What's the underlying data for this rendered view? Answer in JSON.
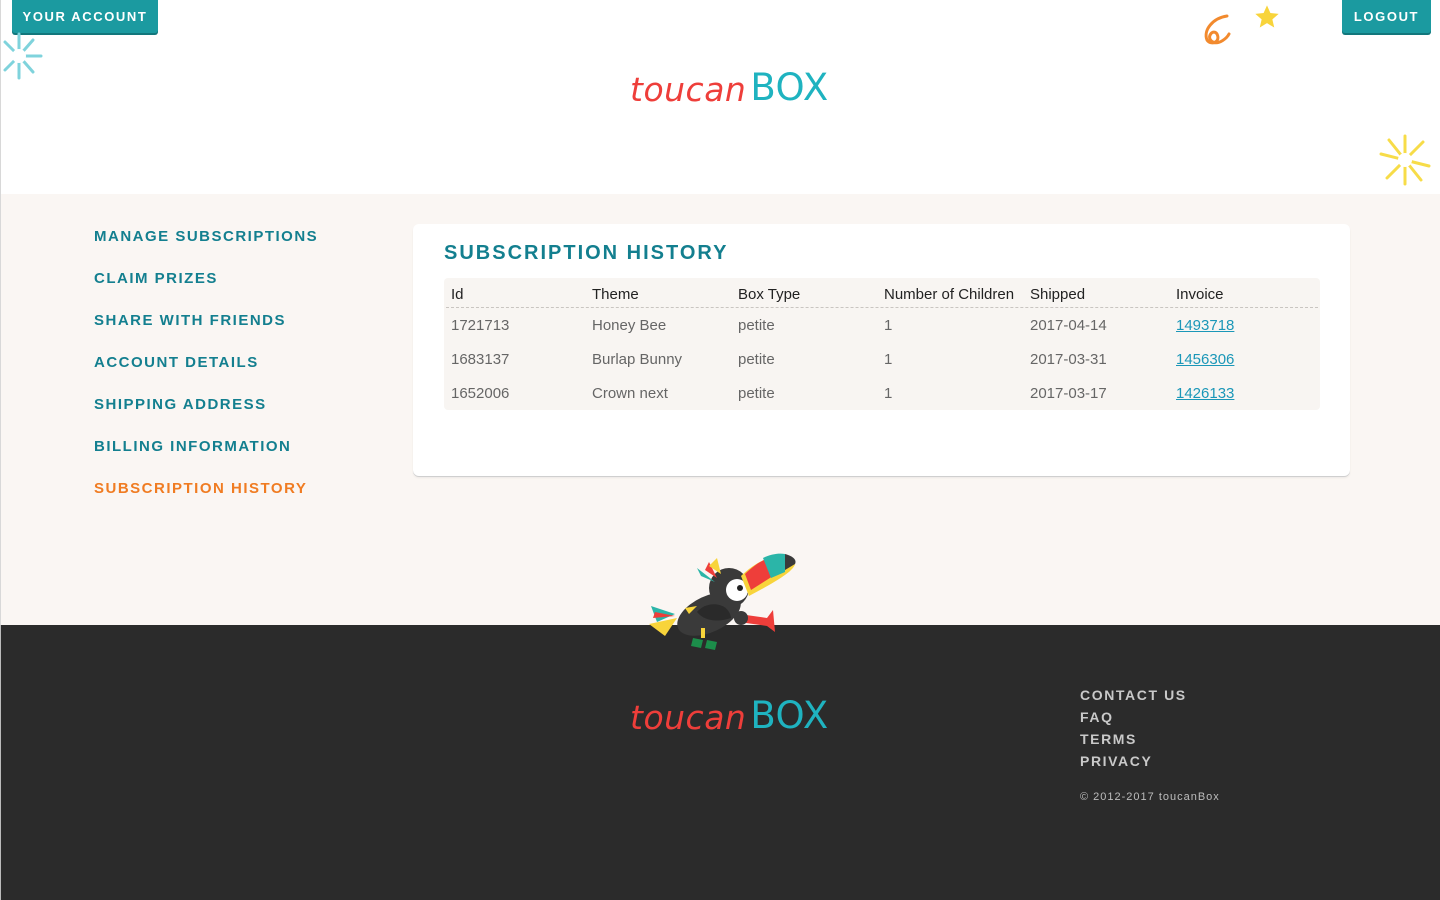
{
  "header": {
    "account_button": "YOUR ACCOUNT",
    "logout_button": "LOGOUT",
    "logo_part1": "toucan",
    "logo_part2": "BOX"
  },
  "sidebar": {
    "items": [
      {
        "label": "MANAGE SUBSCRIPTIONS",
        "active": false
      },
      {
        "label": "CLAIM PRIZES",
        "active": false
      },
      {
        "label": "SHARE WITH FRIENDS",
        "active": false
      },
      {
        "label": "ACCOUNT DETAILS",
        "active": false
      },
      {
        "label": "SHIPPING ADDRESS",
        "active": false
      },
      {
        "label": "BILLING INFORMATION",
        "active": false
      },
      {
        "label": "SUBSCRIPTION HISTORY",
        "active": true
      }
    ]
  },
  "history": {
    "title": "SUBSCRIPTION HISTORY",
    "columns": [
      "Id",
      "Theme",
      "Box Type",
      "Number of Children",
      "Shipped",
      "Invoice"
    ],
    "rows": [
      {
        "id": "1721713",
        "theme": "Honey Bee",
        "box_type": "petite",
        "children": "1",
        "shipped": "2017-04-14",
        "invoice": "1493718"
      },
      {
        "id": "1683137",
        "theme": "Burlap Bunny",
        "box_type": "petite",
        "children": "1",
        "shipped": "2017-03-31",
        "invoice": "1456306"
      },
      {
        "id": "1652006",
        "theme": "Crown next",
        "box_type": "petite",
        "children": "1",
        "shipped": "2017-03-17",
        "invoice": "1426133"
      }
    ]
  },
  "footer": {
    "logo_part1": "toucan",
    "logo_part2": "BOX",
    "links": [
      "CONTACT US",
      "FAQ",
      "TERMS",
      "PRIVACY"
    ],
    "copyright": "© 2012-2017 toucanBox"
  },
  "colors": {
    "teal": "#1b9aa0",
    "nav_teal": "#137f8f",
    "active_orange": "#f07c22",
    "logo_red": "#ee3e3a",
    "logo_cyan": "#1fb3c0",
    "footer_bg": "#2b2b2b",
    "link_blue": "#1b97b8"
  },
  "icons": [
    "burst-teal-icon",
    "squiggle-orange-icon",
    "star-yellow-icon",
    "burst-yellow-icon",
    "toucan-mascot-icon"
  ]
}
